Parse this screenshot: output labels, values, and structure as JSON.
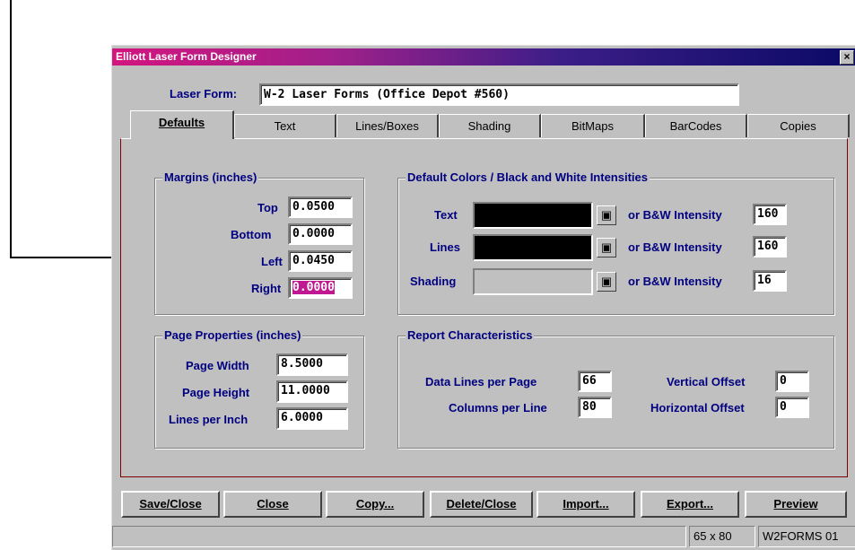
{
  "window": {
    "title": "Elliott Laser Form Designer",
    "close_glyph": "×"
  },
  "laser_form": {
    "label": "Laser Form:",
    "value": "W-2 Laser Forms (Office Depot #560)"
  },
  "tabs": [
    {
      "label": "Defaults",
      "active": true
    },
    {
      "label": "Text"
    },
    {
      "label": "Lines/Boxes"
    },
    {
      "label": "Shading"
    },
    {
      "label": "BitMaps"
    },
    {
      "label": "BarCodes"
    },
    {
      "label": "Copies"
    }
  ],
  "margins": {
    "title": "Margins (inches)",
    "top_label": "Top",
    "top_value": "0.0500",
    "bottom_label": "Bottom",
    "bottom_value": "0.0000",
    "left_label": "Left",
    "left_value": "0.0450",
    "right_label": "Right",
    "right_value": "0.0000"
  },
  "colors": {
    "title": "Default Colors / Black and White Intensities",
    "text_label": "Text",
    "text_color": "#000000",
    "text_intensity_label": "or B&W Intensity",
    "text_intensity": "160",
    "lines_label": "Lines",
    "lines_color": "#000000",
    "lines_intensity_label": "or B&W Intensity",
    "lines_intensity": "160",
    "shading_label": "Shading",
    "shading_color": "#c0c0c0",
    "shading_intensity_label": "or B&W Intensity",
    "shading_intensity": "16",
    "picker_icon": "palette-icon"
  },
  "page": {
    "title": "Page Properties (inches)",
    "width_label": "Page Width",
    "width_value": "8.5000",
    "height_label": "Page Height",
    "height_value": "11.0000",
    "lpi_label": "Lines per Inch",
    "lpi_value": "6.0000"
  },
  "report": {
    "title": "Report Characteristics",
    "lines_label": "Data Lines per Page",
    "lines_value": "66",
    "cols_label": "Columns per Line",
    "cols_value": "80",
    "voff_label": "Vertical Offset",
    "voff_value": "0",
    "hoff_label": "Horizontal Offset",
    "hoff_value": "0"
  },
  "buttons": {
    "save": "Save/Close",
    "close": "Close",
    "copy": "Copy...",
    "delete": "Delete/Close",
    "import": "Import...",
    "export": "Export...",
    "preview": "Preview"
  },
  "status": {
    "message": "",
    "size": "65 x 80",
    "form_id": "W2FORMS 01"
  }
}
